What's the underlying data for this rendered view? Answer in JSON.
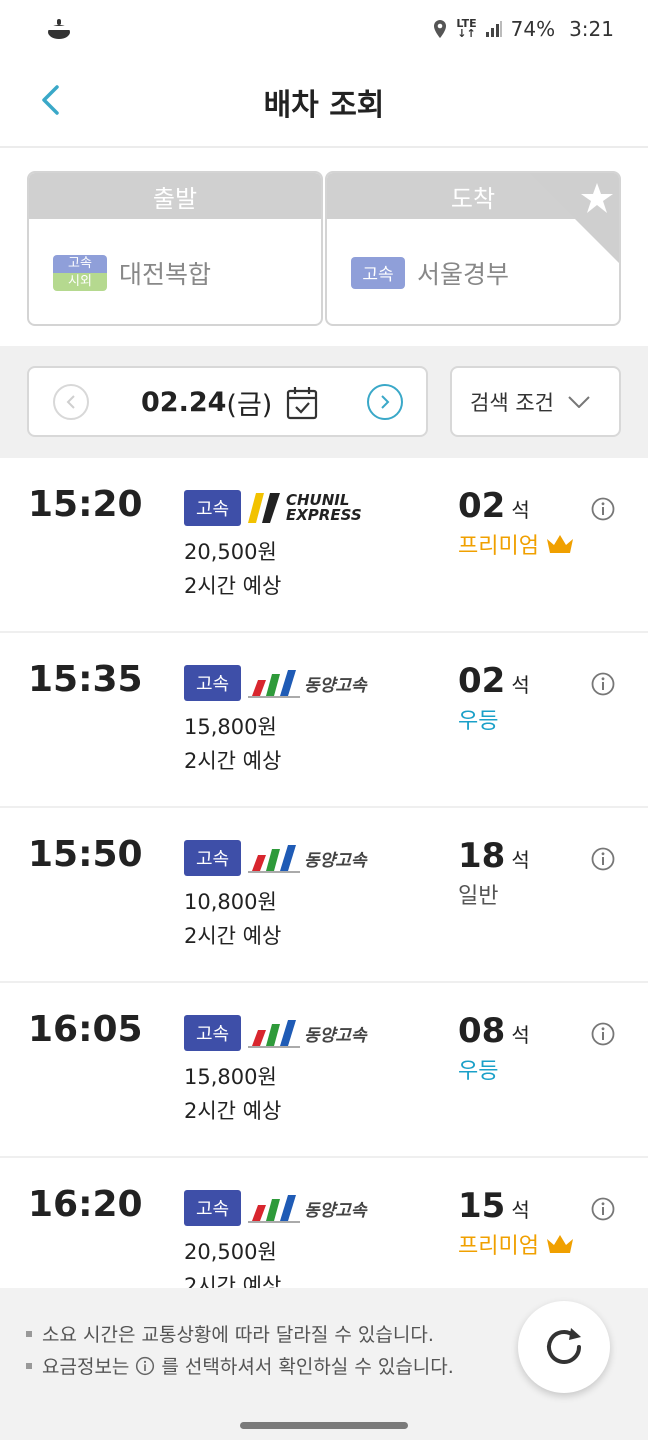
{
  "status": {
    "battery": "74%",
    "time": "3:21",
    "network": "LTE"
  },
  "header": {
    "title": "배차 조회"
  },
  "route": {
    "departure": {
      "label": "출발",
      "badge_top": "고속",
      "badge_bottom": "시외",
      "place": "대전복합"
    },
    "arrival": {
      "label": "도착",
      "badge": "고속",
      "place": "서울경부"
    }
  },
  "date": {
    "value": "02.24",
    "weekday": "(금)"
  },
  "filter": {
    "label": "검색 조건"
  },
  "seat_unit": "석",
  "trips": [
    {
      "time": "15:20",
      "grade": "고속",
      "company": "CHUNIL EXPRESS",
      "price": "20,500원",
      "duration": "2시간 예상",
      "seats": "02",
      "class": "프리미엄",
      "class_color": "#f0a000",
      "crown": true
    },
    {
      "time": "15:35",
      "grade": "고속",
      "company": "동양고속",
      "price": "15,800원",
      "duration": "2시간 예상",
      "seats": "02",
      "class": "우등",
      "class_color": "#1aa0c8",
      "crown": false
    },
    {
      "time": "15:50",
      "grade": "고속",
      "company": "동양고속",
      "price": "10,800원",
      "duration": "2시간 예상",
      "seats": "18",
      "class": "일반",
      "class_color": "#555555",
      "crown": false
    },
    {
      "time": "16:05",
      "grade": "고속",
      "company": "동양고속",
      "price": "15,800원",
      "duration": "2시간 예상",
      "seats": "08",
      "class": "우등",
      "class_color": "#1aa0c8",
      "crown": false
    },
    {
      "time": "16:20",
      "grade": "고속",
      "company": "동양고속",
      "price": "20,500원",
      "duration": "2시간 예상",
      "seats": "15",
      "class": "프리미엄",
      "class_color": "#f0a000",
      "crown": true
    }
  ],
  "notice": {
    "line1": "소요 시간은 교통상황에 따라 달라질 수 있습니다.",
    "line2_pre": "요금정보는",
    "line2_post": "를 선택하셔서 확인하실 수 있습니다."
  },
  "colors": {
    "accent": "#1aa0c8",
    "badge_blue": "#3e4fa8",
    "premium": "#f0a000"
  }
}
